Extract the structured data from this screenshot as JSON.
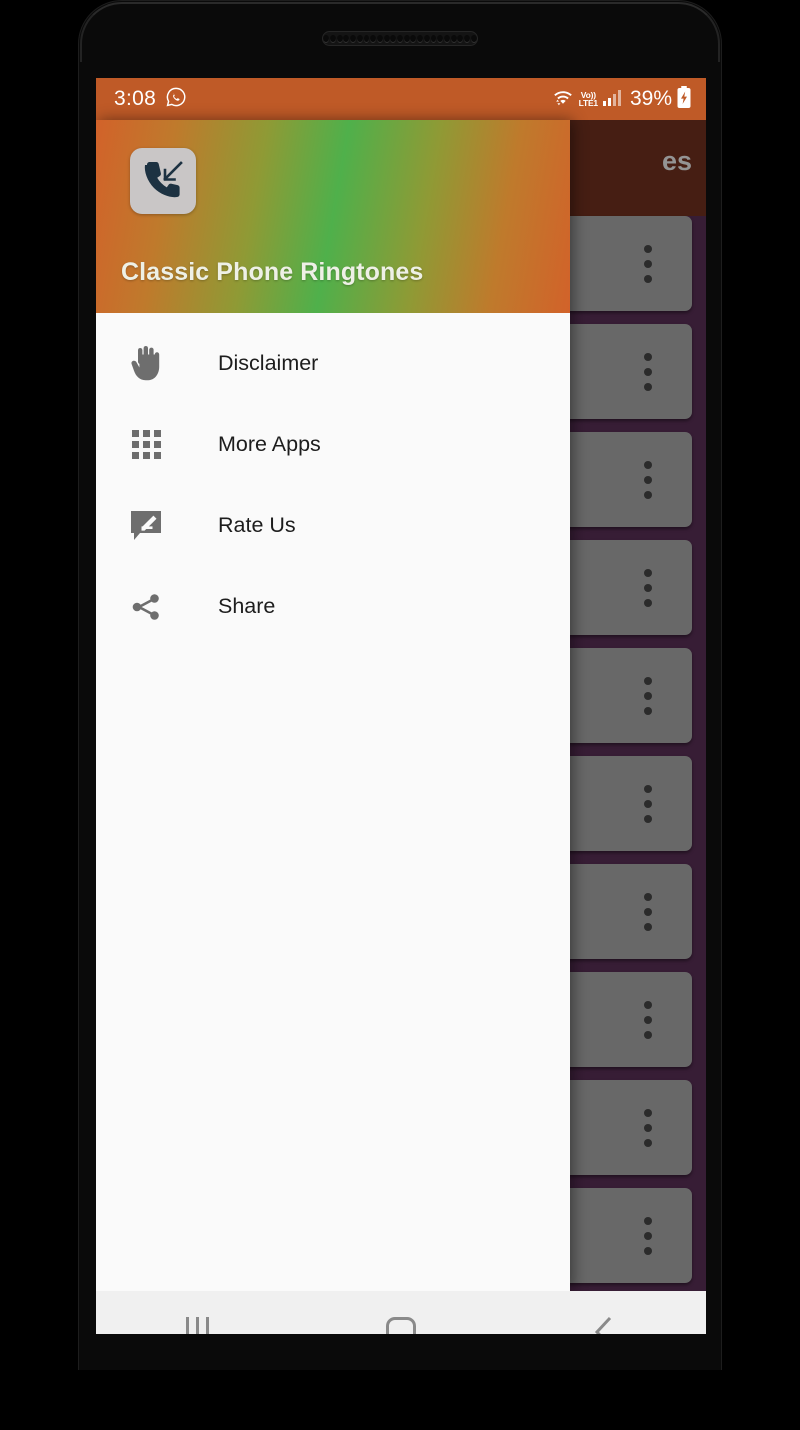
{
  "device": {
    "speaker_icon": "speaker-grille"
  },
  "statusbar": {
    "time": "3:08",
    "app_icon": "whatsapp-icon",
    "wifi_icon": "wifi-icon",
    "volte_top": "Vo))",
    "volte_bottom": "LTE1",
    "signal_icon": "signal-bars-icon",
    "battery_pct": "39%",
    "battery_icon": "battery-charging-icon",
    "bg_color": "#bf5a27"
  },
  "background_app": {
    "app_bar_title_visible": "es",
    "app_bar_color": "#4a2015",
    "page_bg_color": "#3a1f38",
    "cards": [
      {
        "overflow_icon": "more-vert-icon"
      },
      {
        "overflow_icon": "more-vert-icon"
      },
      {
        "overflow_icon": "more-vert-icon"
      },
      {
        "overflow_icon": "more-vert-icon"
      },
      {
        "overflow_icon": "more-vert-icon"
      },
      {
        "overflow_icon": "more-vert-icon"
      },
      {
        "overflow_icon": "more-vert-icon"
      },
      {
        "overflow_icon": "more-vert-icon"
      },
      {
        "overflow_icon": "more-vert-icon"
      },
      {
        "overflow_icon": "more-vert-icon"
      }
    ]
  },
  "drawer": {
    "header": {
      "app_icon": "incoming-call-icon",
      "title": "Classic Phone Ringtones",
      "gradient_start": "#d2622a",
      "gradient_mid": "#4fb04b",
      "gradient_end": "#d2622a"
    },
    "items": [
      {
        "label": "Disclaimer",
        "icon": "hand-icon"
      },
      {
        "label": "More Apps",
        "icon": "apps-grid-icon"
      },
      {
        "label": "Rate Us",
        "icon": "rate-review-icon"
      },
      {
        "label": "Share",
        "icon": "share-icon"
      }
    ]
  },
  "navbar": {
    "recents_label": "recents-icon",
    "home_label": "home-icon",
    "back_label": "back-icon",
    "bg_color": "#f0f0f0"
  }
}
